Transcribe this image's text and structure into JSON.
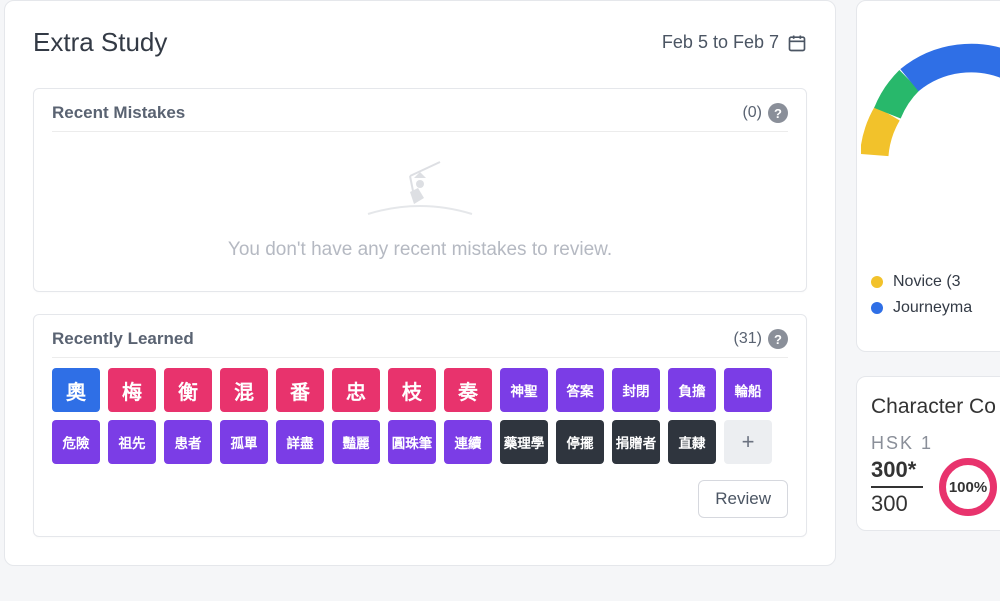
{
  "colors": {
    "blue": "#2f6fe6",
    "pink": "#e8336d",
    "purple": "#7b3de6",
    "dark": "#2f353e",
    "yellow": "#f2c22b",
    "green": "#28b86b"
  },
  "extraStudy": {
    "title": "Extra Study",
    "dateRange": "Feb 5 to Feb 7",
    "recentMistakes": {
      "title": "Recent Mistakes",
      "count": "(0)",
      "emptyText": "You don't have any recent mistakes to review."
    },
    "recentlyLearned": {
      "title": "Recently Learned",
      "count": "(31)",
      "tiles": [
        {
          "text": "奧",
          "color": "blue",
          "size": "big"
        },
        {
          "text": "梅",
          "color": "pink",
          "size": "big"
        },
        {
          "text": "衡",
          "color": "pink",
          "size": "big"
        },
        {
          "text": "混",
          "color": "pink",
          "size": "big"
        },
        {
          "text": "番",
          "color": "pink",
          "size": "big"
        },
        {
          "text": "忠",
          "color": "pink",
          "size": "big"
        },
        {
          "text": "枝",
          "color": "pink",
          "size": "big"
        },
        {
          "text": "奏",
          "color": "pink",
          "size": "big"
        },
        {
          "text": "神聖",
          "color": "purple",
          "size": "small"
        },
        {
          "text": "答案",
          "color": "purple",
          "size": "small"
        },
        {
          "text": "封閉",
          "color": "purple",
          "size": "small"
        },
        {
          "text": "負擔",
          "color": "purple",
          "size": "small"
        },
        {
          "text": "輪船",
          "color": "purple",
          "size": "small"
        },
        {
          "text": "危險",
          "color": "purple",
          "size": "small"
        },
        {
          "text": "祖先",
          "color": "purple",
          "size": "small"
        },
        {
          "text": "患者",
          "color": "purple",
          "size": "small"
        },
        {
          "text": "孤單",
          "color": "purple",
          "size": "small"
        },
        {
          "text": "詳盡",
          "color": "purple",
          "size": "small"
        },
        {
          "text": "豔麗",
          "color": "purple",
          "size": "small"
        },
        {
          "text": "圓珠筆",
          "color": "purple",
          "size": "small"
        },
        {
          "text": "連續",
          "color": "purple",
          "size": "small"
        },
        {
          "text": "藥理學",
          "color": "dark",
          "size": "small"
        },
        {
          "text": "停擺",
          "color": "dark",
          "size": "small"
        },
        {
          "text": "捐贈者",
          "color": "dark",
          "size": "small"
        },
        {
          "text": "直隸",
          "color": "dark",
          "size": "small"
        }
      ],
      "moreTile": "+",
      "reviewBtn": "Review"
    }
  },
  "gauge": {
    "legend": [
      {
        "label": "Novice (3",
        "color": "y"
      },
      {
        "label": "Journeyma",
        "color": "b"
      }
    ]
  },
  "characterCoverage": {
    "title": "Character Co",
    "levelLabel": "HSK 1",
    "numerator": "300*",
    "denominator": "300",
    "percent": "100%"
  }
}
